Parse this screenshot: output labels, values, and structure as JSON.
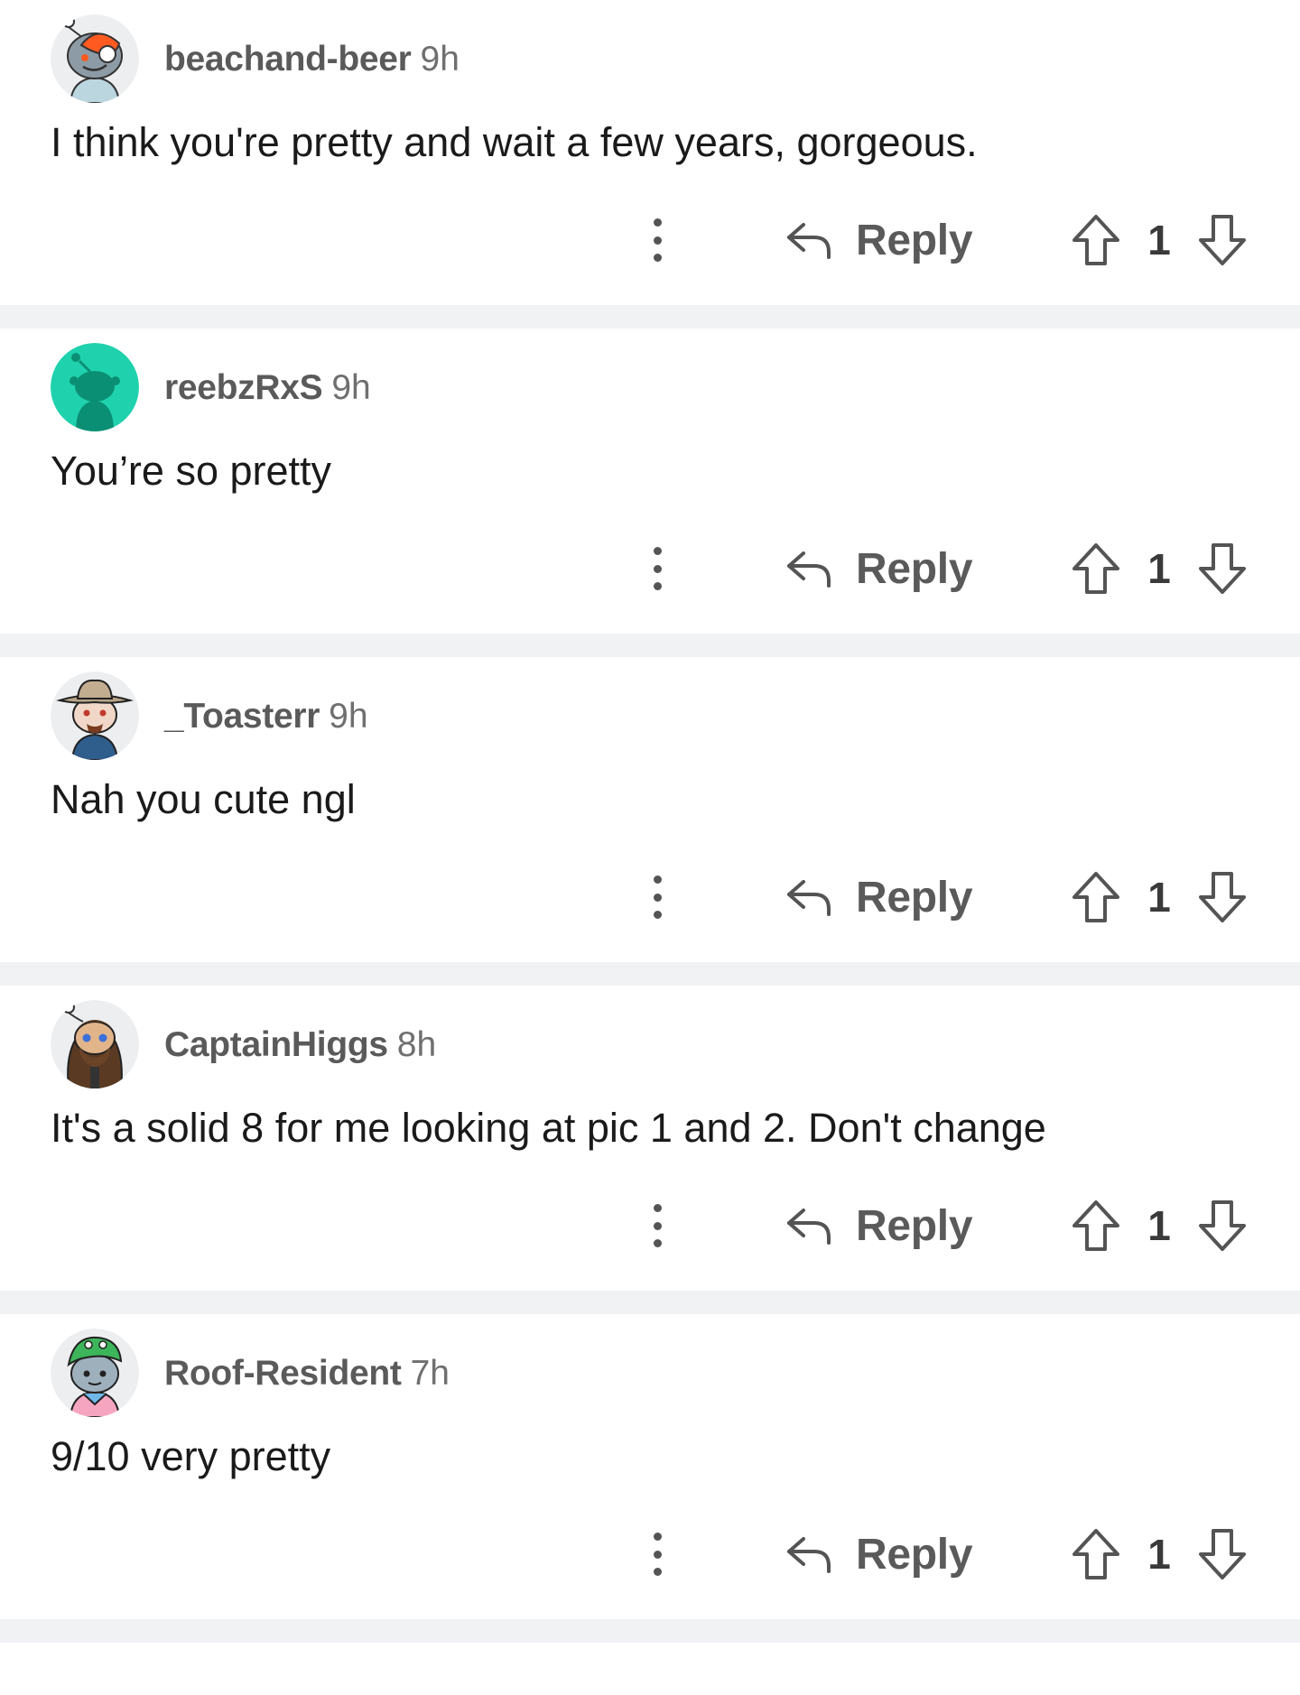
{
  "comments": [
    {
      "username": "beachand-beer",
      "time": "9h",
      "text": "I think you're pretty and wait a few years, gorgeous.",
      "reply_label": "Reply",
      "votes": "1",
      "avatar": "snoo-gray-orange-hair-avatar"
    },
    {
      "username": "reebzRxS",
      "time": "9h",
      "text": "You’re so pretty",
      "reply_label": "Reply",
      "votes": "1",
      "avatar": "default-snoo-teal-avatar"
    },
    {
      "username": "_Toasterr",
      "time": "9h",
      "text": "Nah you cute ngl",
      "reply_label": "Reply",
      "votes": "1",
      "avatar": "snoo-cowboy-hat-avatar"
    },
    {
      "username": "CaptainHiggs",
      "time": "8h",
      "text": "It's a solid 8 for me looking at pic 1 and 2. Don't change",
      "reply_label": "Reply",
      "votes": "1",
      "avatar": "snoo-bearded-avatar"
    },
    {
      "username": "Roof-Resident",
      "time": "7h",
      "text": "9/10 very pretty",
      "reply_label": "Reply",
      "votes": "1",
      "avatar": "snoo-green-hat-avatar"
    }
  ],
  "colors": {
    "separator": "#f1f2f4",
    "username": "#5a5a5a",
    "icon": "#545454",
    "teal_avatar": "#1fd2ad"
  }
}
